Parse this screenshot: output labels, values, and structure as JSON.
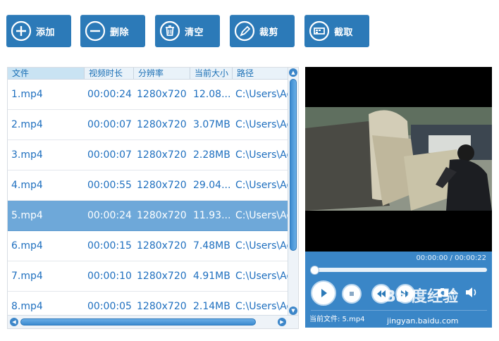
{
  "toolbar": {
    "buttons": [
      {
        "label": "添加",
        "icon": "plus-circle-icon"
      },
      {
        "label": "删除",
        "icon": "minus-circle-icon"
      },
      {
        "label": "清空",
        "icon": "trash-icon"
      },
      {
        "label": "裁剪",
        "icon": "pen-icon"
      },
      {
        "label": "截取",
        "icon": "crop-icon"
      }
    ]
  },
  "file_list": {
    "columns": [
      "文件",
      "视频时长",
      "分辨率",
      "当前大小",
      "路径"
    ],
    "rows": [
      {
        "name": "1.mp4",
        "duration": "00:00:24",
        "resolution": "1280x720",
        "size": "12.08...",
        "path": "C:\\Users\\Ad"
      },
      {
        "name": "2.mp4",
        "duration": "00:00:07",
        "resolution": "1280x720",
        "size": "3.07MB",
        "path": "C:\\Users\\Ad"
      },
      {
        "name": "3.mp4",
        "duration": "00:00:07",
        "resolution": "1280x720",
        "size": "2.28MB",
        "path": "C:\\Users\\Ad"
      },
      {
        "name": "4.mp4",
        "duration": "00:00:55",
        "resolution": "1280x720",
        "size": "29.04...",
        "path": "C:\\Users\\Ad"
      },
      {
        "name": "5.mp4",
        "duration": "00:00:24",
        "resolution": "1280x720",
        "size": "11.93...",
        "path": "C:\\Users\\Ad"
      },
      {
        "name": "6.mp4",
        "duration": "00:00:15",
        "resolution": "1280x720",
        "size": "7.48MB",
        "path": "C:\\Users\\Ad"
      },
      {
        "name": "7.mp4",
        "duration": "00:00:10",
        "resolution": "1280x720",
        "size": "4.91MB",
        "path": "C:\\Users\\Ad"
      },
      {
        "name": "8.mp4",
        "duration": "00:00:05",
        "resolution": "1280x720",
        "size": "2.14MB",
        "path": "C:\\Users\\Ad"
      }
    ],
    "selected_index": 4
  },
  "player": {
    "time_display": "00:00:00 / 00:00:22",
    "progress": 0,
    "current_file": "当前文件: 5.mp4"
  },
  "watermark": {
    "brand": "Bai度经验",
    "url": "jingyan.baidu.com"
  },
  "colors": {
    "accent": "#2c7ab8",
    "selected_row": "#6ea8d9",
    "text_blue": "#1e6fbf"
  }
}
